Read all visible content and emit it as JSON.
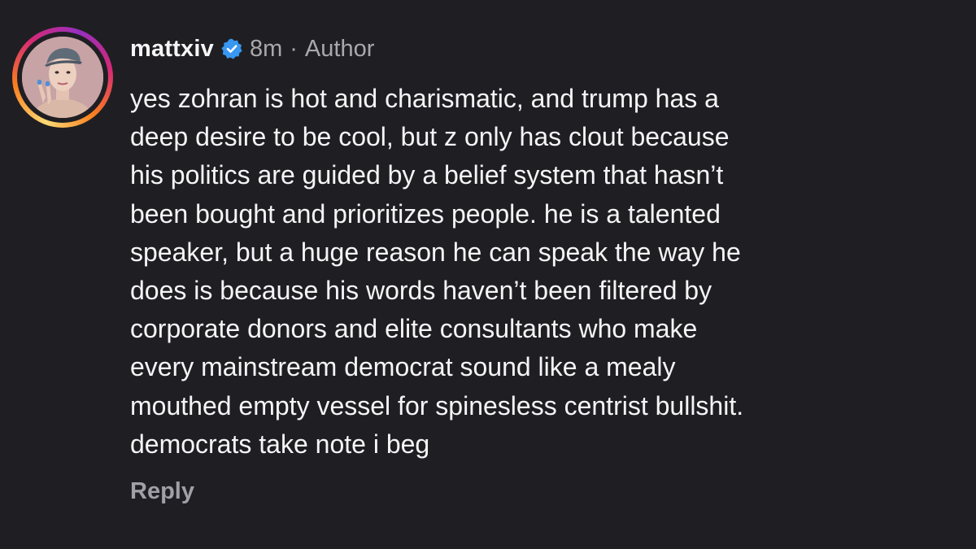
{
  "comment": {
    "username": "mattxiv",
    "verified": true,
    "time": "8m",
    "separator": "·",
    "role": "Author",
    "lines": [
      "yes zohran is hot and charismatic, and trump has a",
      "deep desire to be cool, but z only has clout because",
      "his politics are guided by a belief system that hasn’t",
      "been bought and prioritizes people. he is a talented",
      "speaker, but a huge reason he can speak the way he",
      "does is because his words haven’t been filtered by",
      "corporate donors and elite consultants who make",
      "every mainstream democrat sound like a mealy",
      "mouthed empty vessel for spinesless centrist bullshit.",
      "democrats take note i beg"
    ],
    "reply_label": "Reply"
  },
  "colors": {
    "background": "#1f1f23",
    "text": "#f5f5f7",
    "muted": "#a8a8ad",
    "verified_badge": "#3897f0"
  },
  "icons": {
    "verified": "verified-badge-icon"
  }
}
